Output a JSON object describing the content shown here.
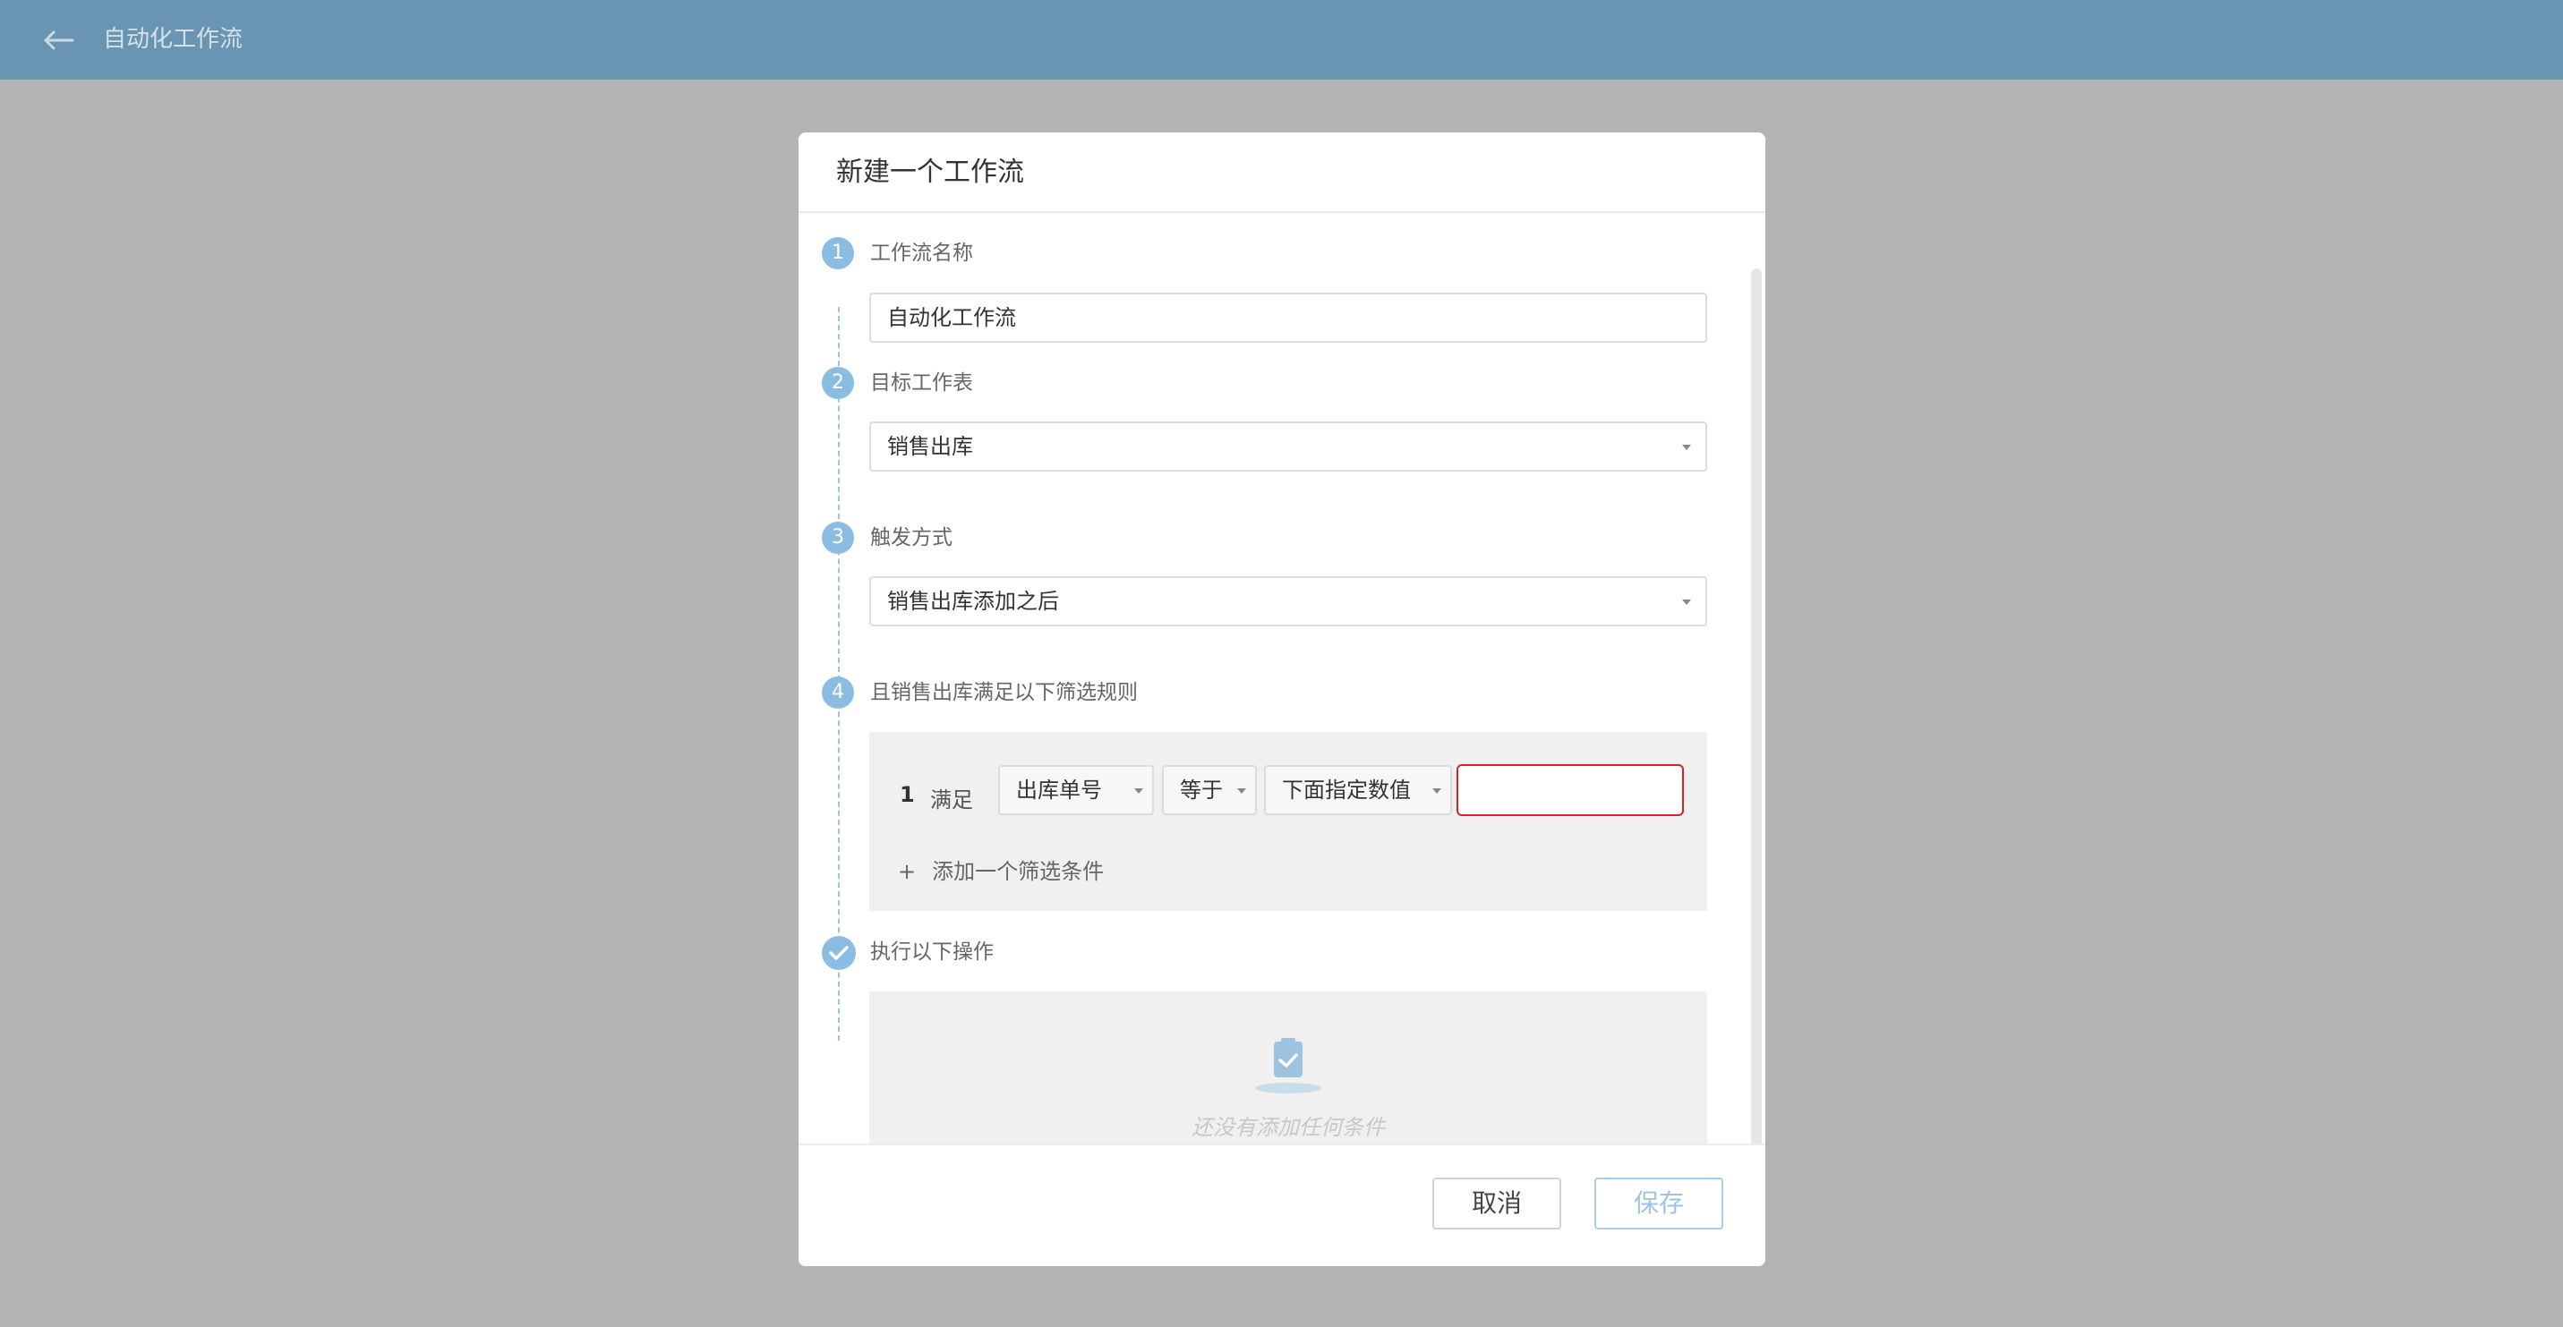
{
  "app": {
    "title": "自动化工作流",
    "back_icon": "arrow-left-icon"
  },
  "dialog": {
    "title": "新建一个工作流",
    "steps": [
      {
        "number": "1",
        "label": "工作流名称",
        "value": "自动化工作流"
      },
      {
        "number": "2",
        "label": "目标工作表",
        "value": "销售出库"
      },
      {
        "number": "3",
        "label": "触发方式",
        "value": "销售出库添加之后"
      },
      {
        "number": "4",
        "label": "且销售出库满足以下筛选规则"
      }
    ],
    "filter": {
      "index": "1",
      "satisfy_label": "满足",
      "field": "出库单号",
      "operator": "等于",
      "value_source": "下面指定数值",
      "value": "",
      "add_label": "添加一个筛选条件",
      "add_icon": "+"
    },
    "actions": {
      "label": "执行以下操作",
      "empty_text": "还没有添加任何条件",
      "icon": "clipboard-check-icon"
    },
    "footer": {
      "cancel_label": "取消",
      "save_label": "保存"
    }
  },
  "colors": {
    "topbar": "#6a95b2",
    "accent": "#8bbde3",
    "error_border": "#e02020"
  }
}
